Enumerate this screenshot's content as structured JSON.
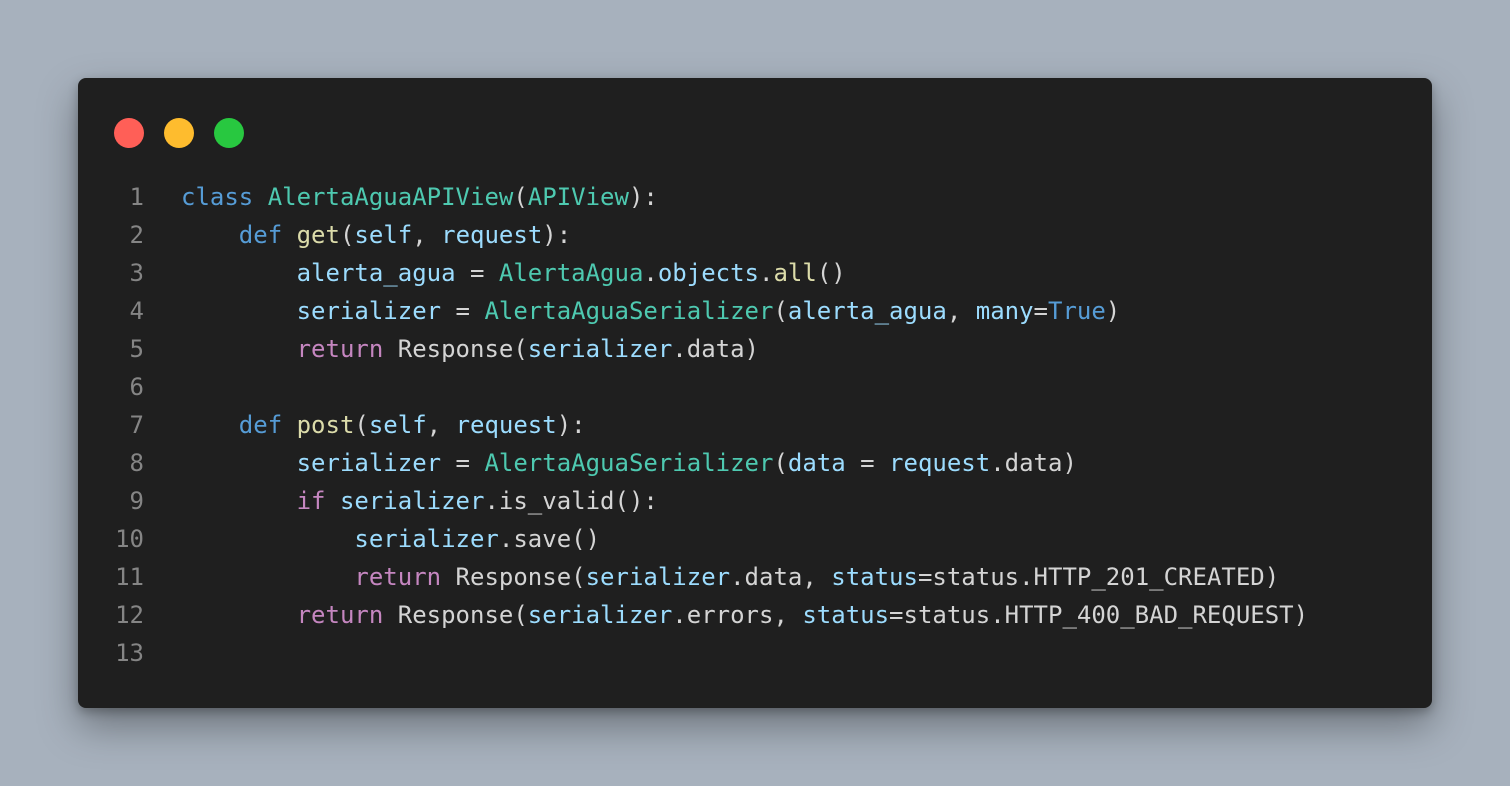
{
  "colors": {
    "background": "#a7b1bd",
    "editor_bg": "#1f1f1f",
    "close": "#ff5f57",
    "minimize": "#febc2e",
    "maximize": "#28c840",
    "keyword": "#569cd6",
    "control": "#c586c0",
    "class_name": "#4ec9b0",
    "function": "#dcdcaa",
    "variable": "#9cdcfe",
    "text": "#d4d4d4",
    "line_number": "#858585"
  },
  "window_controls": [
    {
      "name": "close-dot",
      "color": "#ff5f57"
    },
    {
      "name": "minimize-dot",
      "color": "#febc2e"
    },
    {
      "name": "maximize-dot",
      "color": "#28c840"
    }
  ],
  "code": {
    "lines": [
      {
        "num": "1",
        "tokens": [
          {
            "t": "class",
            "c": "kw"
          },
          {
            "t": " ",
            "c": "plain"
          },
          {
            "t": "AlertaAguaAPIView",
            "c": "cls"
          },
          {
            "t": "(",
            "c": "plain"
          },
          {
            "t": "APIView",
            "c": "cls"
          },
          {
            "t": "):",
            "c": "plain"
          }
        ]
      },
      {
        "num": "2",
        "tokens": [
          {
            "t": "    ",
            "c": "plain"
          },
          {
            "t": "def",
            "c": "kw"
          },
          {
            "t": " ",
            "c": "plain"
          },
          {
            "t": "get",
            "c": "fn"
          },
          {
            "t": "(",
            "c": "plain"
          },
          {
            "t": "self",
            "c": "var"
          },
          {
            "t": ", ",
            "c": "plain"
          },
          {
            "t": "request",
            "c": "var"
          },
          {
            "t": "):",
            "c": "plain"
          }
        ]
      },
      {
        "num": "3",
        "tokens": [
          {
            "t": "        ",
            "c": "plain"
          },
          {
            "t": "alerta_agua",
            "c": "var"
          },
          {
            "t": " = ",
            "c": "plain"
          },
          {
            "t": "AlertaAgua",
            "c": "cls"
          },
          {
            "t": ".",
            "c": "plain"
          },
          {
            "t": "objects",
            "c": "var"
          },
          {
            "t": ".",
            "c": "plain"
          },
          {
            "t": "all",
            "c": "fn"
          },
          {
            "t": "()",
            "c": "plain"
          }
        ]
      },
      {
        "num": "4",
        "tokens": [
          {
            "t": "        ",
            "c": "plain"
          },
          {
            "t": "serializer",
            "c": "var"
          },
          {
            "t": " = ",
            "c": "plain"
          },
          {
            "t": "AlertaAguaSerializer",
            "c": "cls"
          },
          {
            "t": "(",
            "c": "plain"
          },
          {
            "t": "alerta_agua",
            "c": "var"
          },
          {
            "t": ", ",
            "c": "plain"
          },
          {
            "t": "many",
            "c": "var"
          },
          {
            "t": "=",
            "c": "plain"
          },
          {
            "t": "True",
            "c": "kw"
          },
          {
            "t": ")",
            "c": "plain"
          }
        ]
      },
      {
        "num": "5",
        "tokens": [
          {
            "t": "        ",
            "c": "plain"
          },
          {
            "t": "return",
            "c": "ctl"
          },
          {
            "t": " Response(",
            "c": "plain"
          },
          {
            "t": "serializer",
            "c": "var"
          },
          {
            "t": ".data)",
            "c": "plain"
          }
        ]
      },
      {
        "num": "6",
        "tokens": []
      },
      {
        "num": "7",
        "tokens": [
          {
            "t": "    ",
            "c": "plain"
          },
          {
            "t": "def",
            "c": "kw"
          },
          {
            "t": " ",
            "c": "plain"
          },
          {
            "t": "post",
            "c": "fn"
          },
          {
            "t": "(",
            "c": "plain"
          },
          {
            "t": "self",
            "c": "var"
          },
          {
            "t": ", ",
            "c": "plain"
          },
          {
            "t": "request",
            "c": "var"
          },
          {
            "t": "):",
            "c": "plain"
          }
        ]
      },
      {
        "num": "8",
        "tokens": [
          {
            "t": "        ",
            "c": "plain"
          },
          {
            "t": "serializer",
            "c": "var"
          },
          {
            "t": " = ",
            "c": "plain"
          },
          {
            "t": "AlertaAguaSerializer",
            "c": "cls"
          },
          {
            "t": "(",
            "c": "plain"
          },
          {
            "t": "data",
            "c": "var"
          },
          {
            "t": " = ",
            "c": "plain"
          },
          {
            "t": "request",
            "c": "var"
          },
          {
            "t": ".data)",
            "c": "plain"
          }
        ]
      },
      {
        "num": "9",
        "tokens": [
          {
            "t": "        ",
            "c": "plain"
          },
          {
            "t": "if",
            "c": "ctl"
          },
          {
            "t": " ",
            "c": "plain"
          },
          {
            "t": "serializer",
            "c": "var"
          },
          {
            "t": ".is_valid():",
            "c": "plain"
          }
        ]
      },
      {
        "num": "10",
        "tokens": [
          {
            "t": "            ",
            "c": "plain"
          },
          {
            "t": "serializer",
            "c": "var"
          },
          {
            "t": ".save()",
            "c": "plain"
          }
        ]
      },
      {
        "num": "11",
        "tokens": [
          {
            "t": "            ",
            "c": "plain"
          },
          {
            "t": "return",
            "c": "ctl"
          },
          {
            "t": " Response(",
            "c": "plain"
          },
          {
            "t": "serializer",
            "c": "var"
          },
          {
            "t": ".data, ",
            "c": "plain"
          },
          {
            "t": "status",
            "c": "var"
          },
          {
            "t": "=status.HTTP_201_CREATED)",
            "c": "plain"
          }
        ]
      },
      {
        "num": "12",
        "tokens": [
          {
            "t": "        ",
            "c": "plain"
          },
          {
            "t": "return",
            "c": "ctl"
          },
          {
            "t": " Response(",
            "c": "plain"
          },
          {
            "t": "serializer",
            "c": "var"
          },
          {
            "t": ".errors, ",
            "c": "plain"
          },
          {
            "t": "status",
            "c": "var"
          },
          {
            "t": "=status.HTTP_400_BAD_REQUEST)",
            "c": "plain"
          }
        ]
      },
      {
        "num": "13",
        "tokens": []
      }
    ]
  }
}
